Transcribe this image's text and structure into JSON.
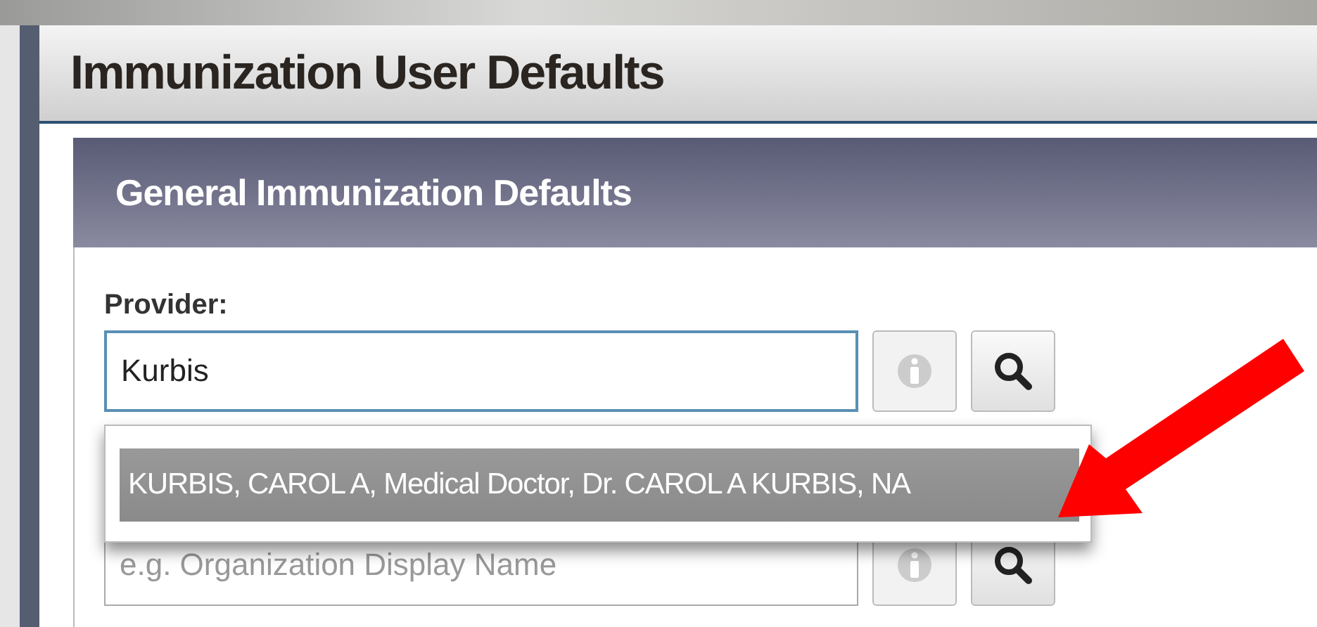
{
  "window": {
    "title": "Immunization User Defaults"
  },
  "section": {
    "title": "General Immunization Defaults"
  },
  "provider": {
    "label": "Provider:",
    "value": "Kurbis",
    "info_button": {
      "disabled": true
    }
  },
  "suggestions": [
    {
      "text": "KURBIS, CAROL A, Medical Doctor, Dr. CAROL A KURBIS, NA",
      "selected": true
    }
  ],
  "organization": {
    "placeholder": "e.g. Organization Display Name",
    "info_button": {
      "disabled": true
    }
  }
}
